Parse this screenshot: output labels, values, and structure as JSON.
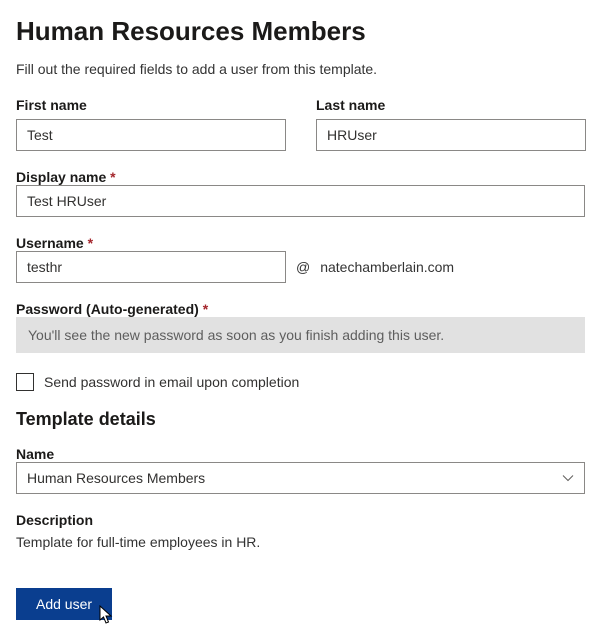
{
  "title": "Human Resources Members",
  "intro": "Fill out the required fields to add a user from this template.",
  "fields": {
    "firstName": {
      "label": "First name",
      "value": "Test"
    },
    "lastName": {
      "label": "Last name",
      "value": "HRUser"
    },
    "displayName": {
      "label": "Display name",
      "value": "Test HRUser"
    },
    "username": {
      "label": "Username",
      "value": "testhr",
      "domain": "natechamberlain.com",
      "at": "@"
    },
    "password": {
      "label": "Password (Auto-generated)",
      "hint": "You'll see the new password as soon as you finish adding this user."
    }
  },
  "sendPassword": {
    "label": "Send password in email upon completion",
    "checked": false
  },
  "templateDetails": {
    "heading": "Template details",
    "nameLabel": "Name",
    "nameValue": "Human Resources Members",
    "descriptionLabel": "Description",
    "descriptionValue": "Template for full-time employees in HR."
  },
  "actions": {
    "addUser": "Add user"
  }
}
